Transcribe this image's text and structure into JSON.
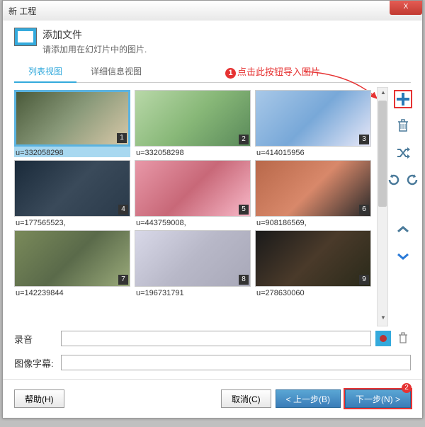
{
  "window": {
    "title": "新 工程"
  },
  "titlebar": {
    "close": "X"
  },
  "header": {
    "title": "添加文件",
    "subtitle": "请添加用在幻灯片中的图片."
  },
  "annotations": {
    "a1": "点击此按钮导入图片",
    "num1": "1",
    "num2": "2"
  },
  "tabs": {
    "list": "列表视图",
    "detail": "详细信息视图"
  },
  "grid": {
    "items": [
      {
        "badge": "1",
        "label": "u=332058298"
      },
      {
        "badge": "2",
        "label": "u=332058298"
      },
      {
        "badge": "3",
        "label": "u=414015956"
      },
      {
        "badge": "4",
        "label": "u=177565523,"
      },
      {
        "badge": "5",
        "label": "u=443759008,"
      },
      {
        "badge": "6",
        "label": "u=908186569,"
      },
      {
        "badge": "7",
        "label": "u=142239844"
      },
      {
        "badge": "8",
        "label": "u=196731791"
      },
      {
        "badge": "9",
        "label": "u=278630060"
      }
    ]
  },
  "sidebar": {
    "add": "+",
    "delete": "🗑",
    "shuffle": "✕",
    "rotate_left": "↺",
    "rotate_right": "↻",
    "up": "︿",
    "down": "﹀"
  },
  "form": {
    "recording_label": "录音",
    "subtitle_label": "图像字幕:",
    "recording_value": "",
    "subtitle_value": ""
  },
  "footer": {
    "help": "帮助(H)",
    "cancel": "取消(C)",
    "prev": "< 上一步(B)",
    "next": "下一步(N) >"
  },
  "colors": {
    "accent": "#34aadc",
    "danger": "#e63333",
    "primary_btn": "#3a7cb8"
  }
}
